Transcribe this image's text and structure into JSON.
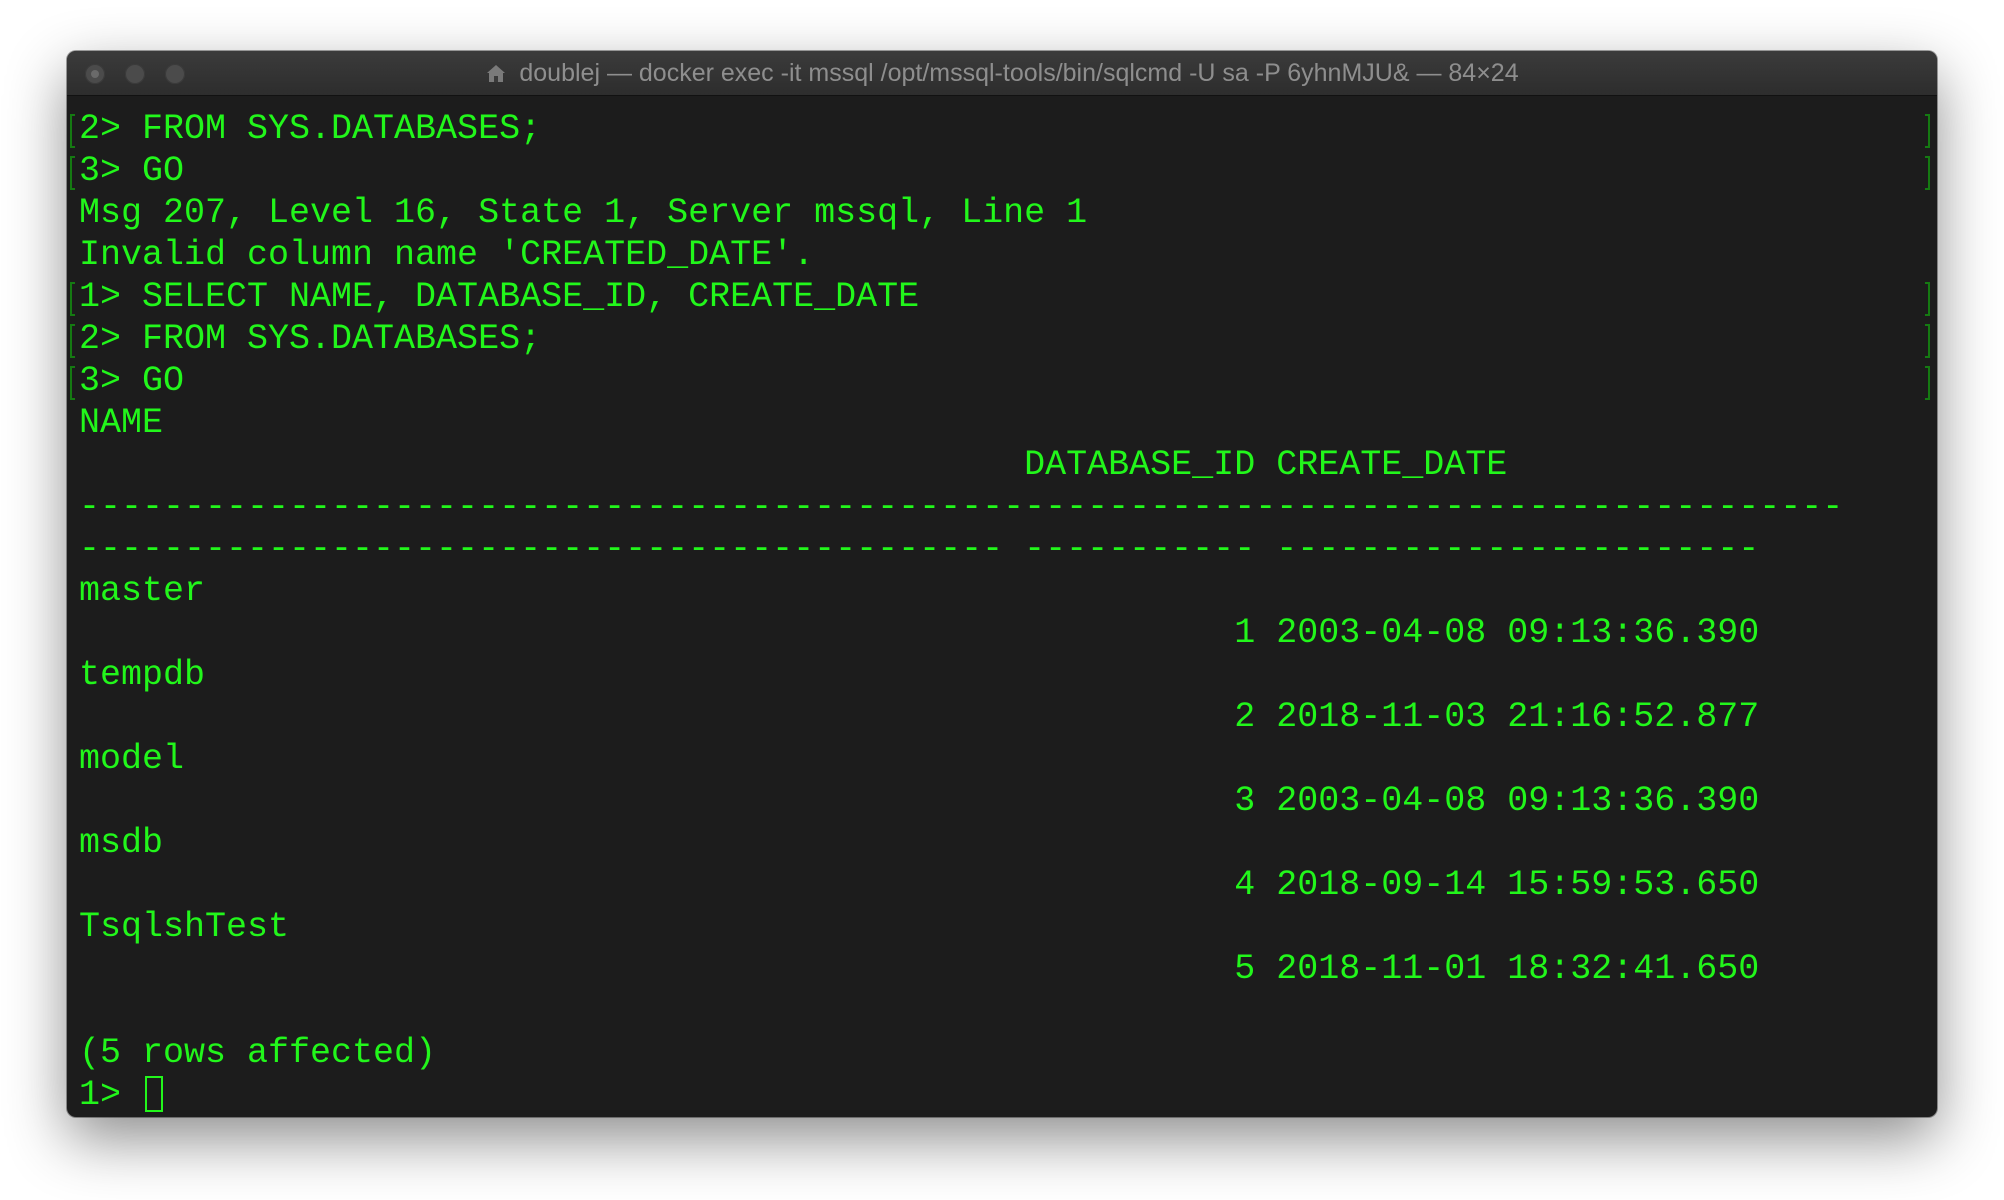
{
  "window": {
    "title": "doublej — docker exec -it mssql /opt/mssql-tools/bin/sqlcmd -U sa -P 6yhnMJU& — 84×24",
    "title_icon": "home-folder-icon"
  },
  "terminal": {
    "text_color": "#22f61b",
    "background": "#1c1c1c",
    "lines": [
      "2> FROM SYS.DATABASES;",
      "3> GO",
      "Msg 207, Level 16, State 1, Server mssql, Line 1",
      "Invalid column name 'CREATED_DATE'.",
      "1> SELECT NAME, DATABASE_ID, CREATE_DATE",
      "2> FROM SYS.DATABASES;",
      "3> GO",
      "NAME",
      "                                             DATABASE_ID CREATE_DATE",
      "------------------------------------------------------------------------------------",
      "-------------------------------------------- ----------- -----------------------",
      "master",
      "                                                       1 2003-04-08 09:13:36.390",
      "tempdb",
      "                                                       2 2018-11-03 21:16:52.877",
      "model",
      "                                                       3 2003-04-08 09:13:36.390",
      "msdb",
      "                                                       4 2018-09-14 15:59:53.650",
      "TsqlshTest",
      "                                                       5 2018-11-01 18:32:41.650",
      "",
      "(5 rows affected)"
    ],
    "prompt": "1> "
  }
}
